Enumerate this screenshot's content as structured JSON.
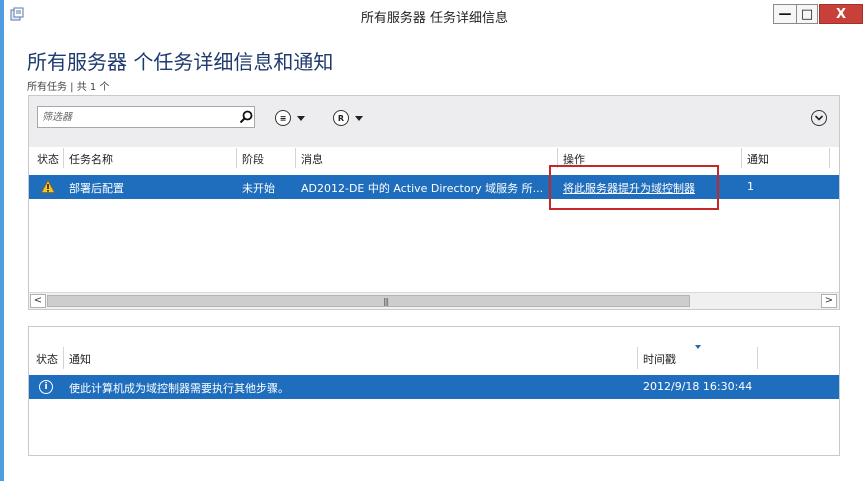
{
  "window": {
    "title": "所有服务器 任务详细信息",
    "min_glyph": "—",
    "max_glyph": "□",
    "close_glyph": "X"
  },
  "page": {
    "title": "所有服务器 个任务详细信息和通知",
    "subtitle": "所有任务 | 共 1 个"
  },
  "filter": {
    "placeholder": "筛选器"
  },
  "task_table": {
    "columns": [
      "状态",
      "任务名称",
      "阶段",
      "消息",
      "操作",
      "通知"
    ],
    "rows": [
      {
        "status_icon": "warning-icon",
        "task_name": "部署后配置",
        "stage": "未开始",
        "message": "AD2012-DE 中的 Active Directory 域服务 所...",
        "action": "将此服务器提升为域控制器",
        "notifications": "1"
      }
    ]
  },
  "notification_table": {
    "columns": [
      "状态",
      "通知",
      "时间戳"
    ],
    "rows": [
      {
        "status_icon": "info-icon",
        "notification": "使此计算机成为域控制器需要执行其他步骤。",
        "timestamp": "2012/9/18 16:30:44"
      }
    ]
  },
  "colors": {
    "selection": "#1f6ebd",
    "title_text": "#1f3a6e",
    "highlight": "#c62828"
  }
}
